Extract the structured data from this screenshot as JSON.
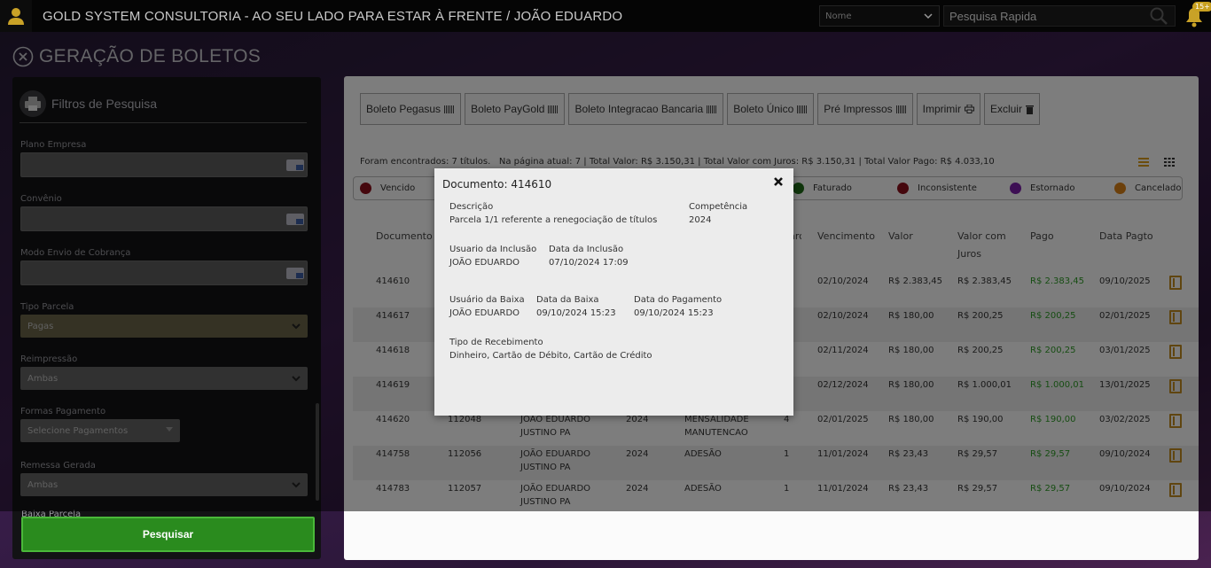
{
  "topbar": {
    "title": "GOLD SYSTEM CONSULTORIA - AO SEU LADO PARA ESTAR À FRENTE / JOÃO EDUARDO",
    "search_select": "Nome",
    "search_placeholder": "Pesquisa Rapida",
    "notification_count": "15+"
  },
  "page": {
    "title": "GERAÇÃO DE BOLETOS"
  },
  "sidebar": {
    "title": "Filtros de Pesquisa",
    "fields": {
      "plano_empresa": "Plano Empresa",
      "convenio": "Convênio",
      "modo_envio": "Modo Envio de Cobrança",
      "tipo_parcela": "Tipo Parcela",
      "tipo_parcela_value": "Pagas",
      "reimpressao": "Reimpressão",
      "reimpressao_value": "Ambas",
      "formas_pagamento": "Formas Pagamento",
      "formas_pagamento_value": "Selecione Pagamentos",
      "remessa_gerada": "Remessa Gerada",
      "remessa_gerada_value": "Ambas",
      "cut_label": "Baixa Parcela"
    },
    "search_button": "Pesquisar"
  },
  "toolbar": {
    "boleto_pegasus": "Boleto Pegasus",
    "boleto_paygold": "Boleto PayGold",
    "boleto_integracao": "Boleto Integracao Bancaria",
    "boleto_unico": "Boleto Único",
    "pre_impressos": "Pré Impressos",
    "imprimir": "Imprimir",
    "excluir": "Excluir"
  },
  "summary": {
    "found": "Foram encontrados: 7 títulos.",
    "page_label": "Na página atual:",
    "page_count": "7",
    "total_valor_label": "Total Valor:",
    "total_valor": "R$ 3.150,31",
    "total_juros_label": "Total Valor com Juros:",
    "total_juros": "R$ 3.150,31",
    "total_pago_label": "Total Valor Pago:",
    "total_pago": "R$ 4.033,10"
  },
  "legend": [
    {
      "label": "Vencido",
      "color": "#8b0f1a"
    },
    {
      "label": "Faturado",
      "color": "#1e6a16"
    },
    {
      "label": "Inconsistente",
      "color": "#8b0f1a"
    },
    {
      "label": "Estornado",
      "color": "#7a1fa8"
    },
    {
      "label": "Cancelado",
      "color": "#d98016"
    }
  ],
  "table": {
    "columns": {
      "documento": "Documento",
      "parc": "Parc",
      "vencimento": "Vencimento",
      "valor": "Valor",
      "valor_juros": "Valor com Juros",
      "pago": "Pago",
      "data_pagto": "Data Pagto"
    },
    "rows": [
      {
        "doc": "414610",
        "nosso": "",
        "nome1": "",
        "nome2": "",
        "comp": "",
        "desc1": "",
        "desc2": "",
        "parc": "",
        "venc": "02/10/2024",
        "valor": "R$ 2.383,45",
        "juros": "R$ 2.383,45",
        "pago": "R$ 2.383,45",
        "data": "09/10/2025"
      },
      {
        "doc": "414617",
        "nosso": "",
        "nome1": "",
        "nome2": "",
        "comp": "",
        "desc1": "",
        "desc2": "",
        "parc": "",
        "venc": "02/10/2024",
        "valor": "R$ 180,00",
        "juros": "R$ 200,25",
        "pago": "R$ 200,25",
        "data": "02/01/2025"
      },
      {
        "doc": "414618",
        "nosso": "",
        "nome1": "",
        "nome2": "",
        "comp": "",
        "desc1": "",
        "desc2": "",
        "parc": "",
        "venc": "02/11/2024",
        "valor": "R$ 180,00",
        "juros": "R$ 200,25",
        "pago": "R$ 200,25",
        "data": "03/01/2025"
      },
      {
        "doc": "414619",
        "nosso": "",
        "nome1": "",
        "nome2": "",
        "comp": "",
        "desc1": "",
        "desc2": "",
        "parc": "",
        "venc": "02/12/2024",
        "valor": "R$ 180,00",
        "juros": "R$ 1.000,01",
        "pago": "R$ 1.000,01",
        "data": "13/01/2025"
      },
      {
        "doc": "414620",
        "nosso": "112048",
        "nome1": "JOAO EDUARDO",
        "nome2": "JUSTINO PA",
        "comp": "2024",
        "desc1": "MENSALIDADE",
        "desc2": "MANUTENCAO",
        "parc": "4",
        "venc": "02/01/2025",
        "valor": "R$ 180,00",
        "juros": "R$ 190,00",
        "pago": "R$ 190,00",
        "data": "03/02/2025"
      },
      {
        "doc": "414758",
        "nosso": "112056",
        "nome1": "JOÃO EDUARDO",
        "nome2": "JUSTINO PA",
        "comp": "2024",
        "desc1": "ADESÃO",
        "desc2": "",
        "parc": "1",
        "venc": "11/01/2024",
        "valor": "R$ 23,43",
        "juros": "R$ 29,57",
        "pago": "R$ 29,57",
        "data": "09/10/2024"
      },
      {
        "doc": "414783",
        "nosso": "112057",
        "nome1": "JOÃO EDUARDO",
        "nome2": "JUSTINO PA",
        "comp": "2024",
        "desc1": "ADESÃO",
        "desc2": "",
        "parc": "1",
        "venc": "11/01/2024",
        "valor": "R$ 23,43",
        "juros": "R$ 29,57",
        "pago": "R$ 29,57",
        "data": "09/10/2024"
      }
    ]
  },
  "modal": {
    "title": "Documento: 414610",
    "descricao_label": "Descrição",
    "descricao": "Parcela 1/1 referente a renegociação de títulos",
    "competencia_label": "Competência",
    "competencia": "2024",
    "usuario_inclusao_label": "Usuario da Inclusão",
    "usuario_inclusao": "JOÃO EDUARDO",
    "data_inclusao_label": "Data da Inclusão",
    "data_inclusao": "07/10/2024 17:09",
    "usuario_baixa_label": "Usuário da Baixa",
    "usuario_baixa": "JOÃO EDUARDO",
    "data_baixa_label": "Data da Baixa",
    "data_baixa": "09/10/2024 15:23",
    "data_pagamento_label": "Data do Pagamento",
    "data_pagamento": "09/10/2024 15:23",
    "tipo_recebimento_label": "Tipo de Recebimento",
    "tipo_recebimento": "Dinheiro, Cartão de Débito, Cartão de Crédito"
  }
}
